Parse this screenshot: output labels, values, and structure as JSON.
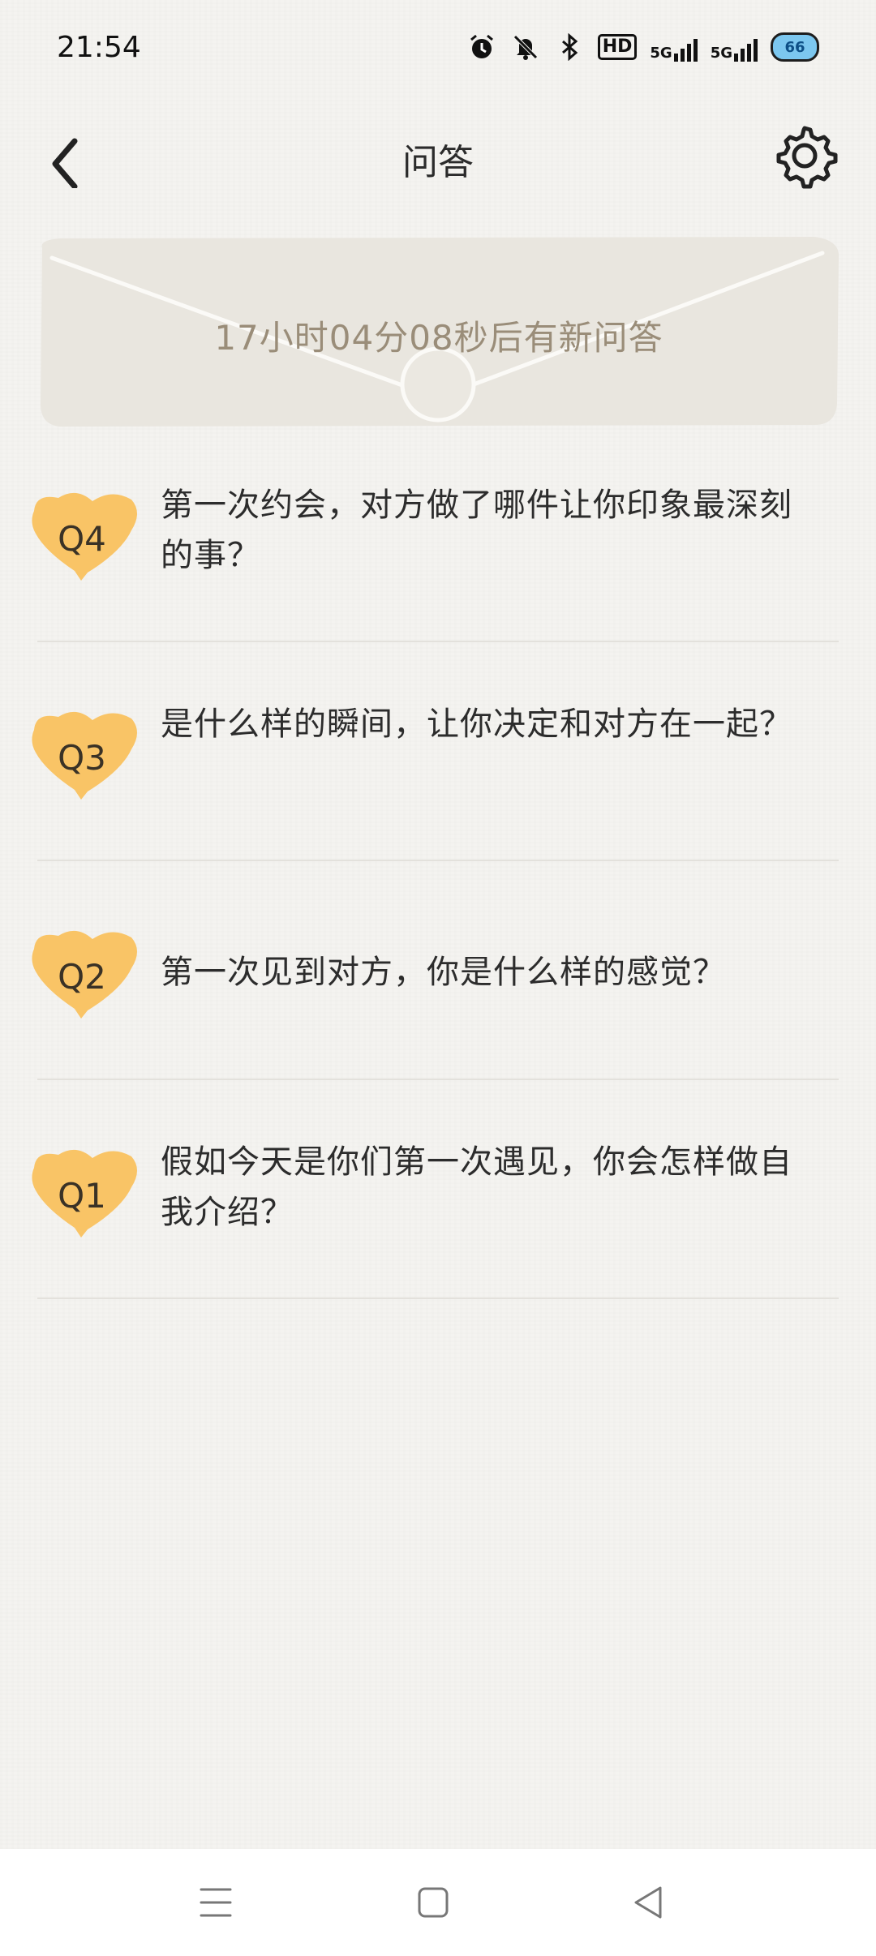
{
  "status_bar": {
    "time": "21:54",
    "network_1": "5G",
    "network_2": "5G",
    "hd_label": "HD",
    "battery": "66"
  },
  "header": {
    "title": "问答"
  },
  "countdown": {
    "text": "17小时04分08秒后有新问答"
  },
  "questions": [
    {
      "label": "Q4",
      "text": "第一次约会，对方做了哪件让你印象最深刻的事？"
    },
    {
      "label": "Q3",
      "text": "是什么样的瞬间，让你决定和对方在一起？"
    },
    {
      "label": "Q2",
      "text": "第一次见到对方，你是什么样的感觉？"
    },
    {
      "label": "Q1",
      "text": "假如今天是你们第一次遇见，你会怎样做自我介绍？"
    }
  ],
  "colors": {
    "badge": "#f9c466",
    "envelope": "#e9e6df",
    "countdown_text": "#9a8d79"
  }
}
